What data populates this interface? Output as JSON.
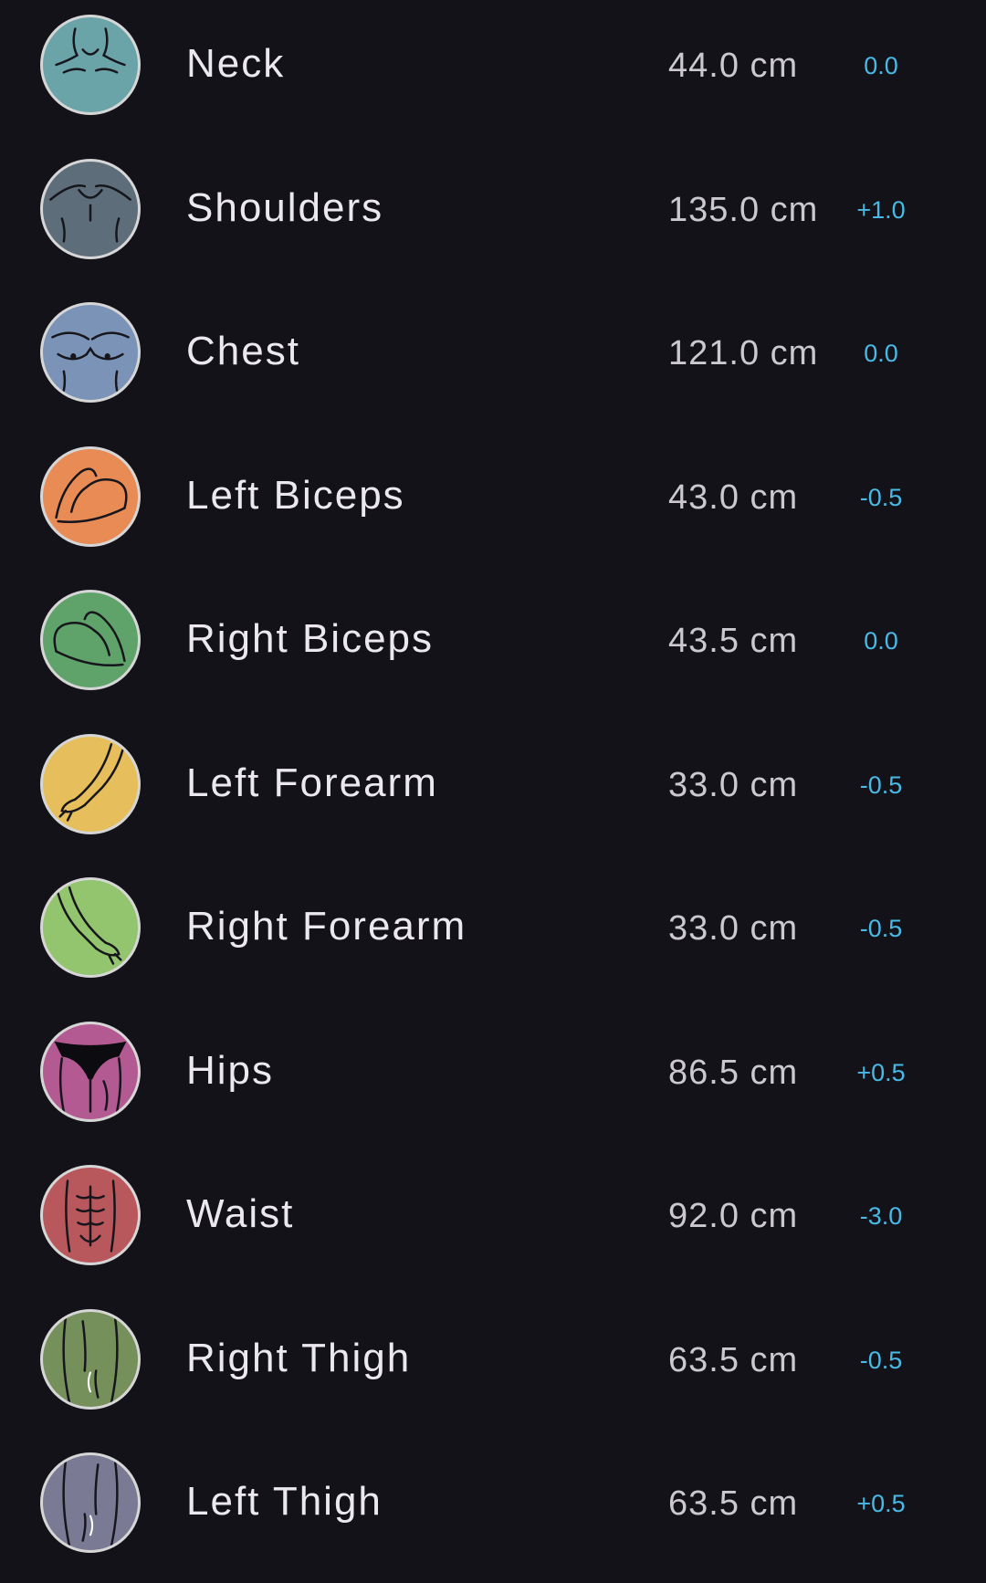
{
  "measurements": [
    {
      "name": "Neck",
      "value": "44.0 cm",
      "change": "0.0",
      "icon": "neck-icon",
      "color": "#6aa3a8"
    },
    {
      "name": "Shoulders",
      "value": "135.0 cm",
      "change": "+1.0",
      "icon": "shoulders-icon",
      "color": "#5d6d7a"
    },
    {
      "name": "Chest",
      "value": "121.0 cm",
      "change": "0.0",
      "icon": "chest-icon",
      "color": "#7a93b7"
    },
    {
      "name": "Left Biceps",
      "value": "43.0 cm",
      "change": "-0.5",
      "icon": "left-biceps-icon",
      "color": "#e88b55"
    },
    {
      "name": "Right Biceps",
      "value": "43.5 cm",
      "change": "0.0",
      "icon": "right-biceps-icon",
      "color": "#5fa36b"
    },
    {
      "name": "Left Forearm",
      "value": "33.0 cm",
      "change": "-0.5",
      "icon": "left-forearm-icon",
      "color": "#e6bf5c"
    },
    {
      "name": "Right Forearm",
      "value": "33.0 cm",
      "change": "-0.5",
      "icon": "right-forearm-icon",
      "color": "#93c46e"
    },
    {
      "name": "Hips",
      "value": "86.5 cm",
      "change": "+0.5",
      "icon": "hips-icon",
      "color": "#b45a92"
    },
    {
      "name": "Waist",
      "value": "92.0 cm",
      "change": "-3.0",
      "icon": "waist-icon",
      "color": "#b9585c"
    },
    {
      "name": "Right Thigh",
      "value": "63.5 cm",
      "change": "-0.5",
      "icon": "right-thigh-icon",
      "color": "#76905c"
    },
    {
      "name": "Left Thigh",
      "value": "63.5 cm",
      "change": "+0.5",
      "icon": "left-thigh-icon",
      "color": "#7b7a95"
    }
  ],
  "change_color": "#49b9e6"
}
